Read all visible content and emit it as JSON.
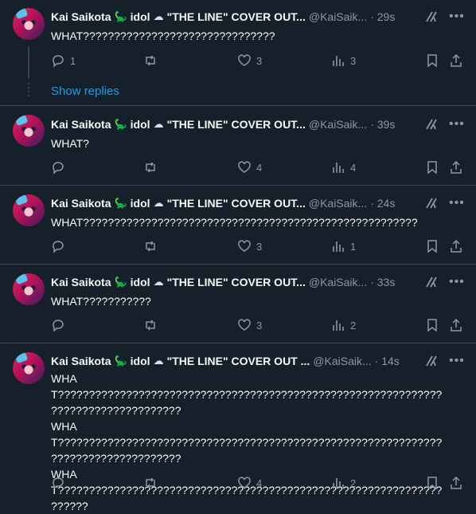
{
  "author": {
    "name": "Kai Saikota",
    "tag": "idol",
    "title_short": "\"THE LINE\" COVER OUT...",
    "title_short_alt": "\"THE LINE\" COVER OUT ...",
    "handle": "@KaiSaik..."
  },
  "thread": {
    "show_replies_label": "Show replies"
  },
  "tweets": [
    {
      "time": "· 29s",
      "text": [
        "WHAT???????????????????????????????"
      ],
      "replies": "1",
      "retweets": "",
      "likes": "3",
      "views": "3"
    },
    {
      "time": "· 39s",
      "text": [
        "WHAT?"
      ],
      "replies": "",
      "retweets": "",
      "likes": "4",
      "views": "4"
    },
    {
      "time": "· 24s",
      "text": [
        "WHAT??????????????????????????????????????????????????????"
      ],
      "replies": "",
      "retweets": "",
      "likes": "3",
      "views": "1"
    },
    {
      "time": "· 33s",
      "text": [
        "WHAT???????????"
      ],
      "replies": "",
      "retweets": "",
      "likes": "3",
      "views": "2"
    },
    {
      "time": "· 14s",
      "text": [
        "WHAT??????????????????????????????????????????????????????????????",
        "?????????????????????",
        "WHAT??????????????????????????????????????????????????????????????",
        "?????????????????????",
        "WHAT??????????????????????????????????????????????????????????????",
        "??????"
      ],
      "replies": "",
      "retweets": "",
      "likes": "4",
      "views": "2"
    }
  ],
  "colors": {
    "background": "#15202b",
    "text": "#f7f9f9",
    "muted": "#8b98a5",
    "link": "#1d9bf0",
    "border": "#38444d"
  }
}
